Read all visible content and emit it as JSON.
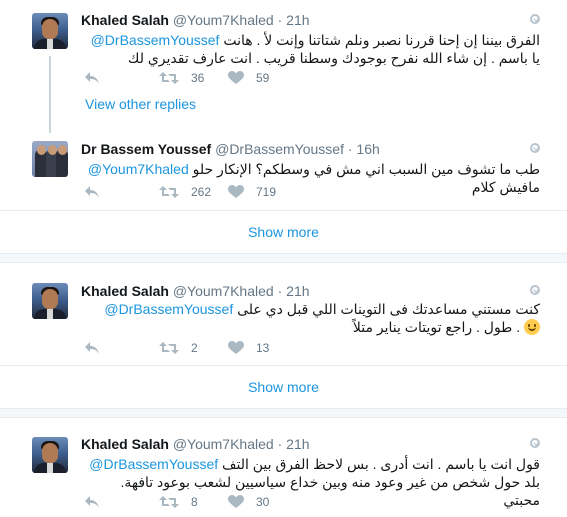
{
  "thread": {
    "view_other_replies": "View other replies",
    "show_more": "Show more"
  },
  "tweets": [
    {
      "name": "Khaled Salah",
      "handle": "@Youm7Khaled",
      "dot": "·",
      "time": "21h",
      "mention": "@DrBassemYoussef",
      "text": "الفرق بيننا إن إحنا قررنا نصبر ونلم شتاتنا وإنت لأ . هانت يا باسم . إن شاء الله نفرح بوجودك وسطنا قريب . انت عارف تقديري لك",
      "retweets": "36",
      "likes": "59"
    },
    {
      "name": "Dr Bassem Youssef",
      "handle": "@DrBassemYoussef",
      "dot": "·",
      "time": "16h",
      "mention": "@Youm7Khaled",
      "text": "طب ما تشوف مين السبب اني مش في وسطكم؟ الإنكار حلو مافيش كلام",
      "retweets": "262",
      "likes": "719"
    },
    {
      "name": "Khaled Salah",
      "handle": "@Youm7Khaled",
      "dot": "·",
      "time": "21h",
      "mention": "@DrBassemYoussef",
      "text": "كنت مستني مساعدتك فى التوينات اللي قبل دي على طول . راجع تويتات يناير متلاً .",
      "retweets": "2",
      "likes": "13"
    },
    {
      "name": "Khaled Salah",
      "handle": "@Youm7Khaled",
      "dot": "·",
      "time": "21h",
      "mention": "@DrBassemYoussef",
      "text": "قول انت يا باسم . انت أدرى . بس لاحظ الفرق بين التف بلد حول شخص من غير وعود منه وبين خداع سياسيين لشعب بوعود تافهة. محبتي",
      "retweets": "8",
      "likes": "30"
    }
  ],
  "icons": {
    "reply": "reply-icon",
    "retweet": "retweet-icon",
    "like": "heart-icon",
    "caret": "chevron-down-icon",
    "emoji": "smiling-face-emoji"
  },
  "colors": {
    "link": "#1b95e0",
    "muted": "#657786",
    "divider": "#e6ecf0",
    "gap": "#f5f8fa"
  }
}
